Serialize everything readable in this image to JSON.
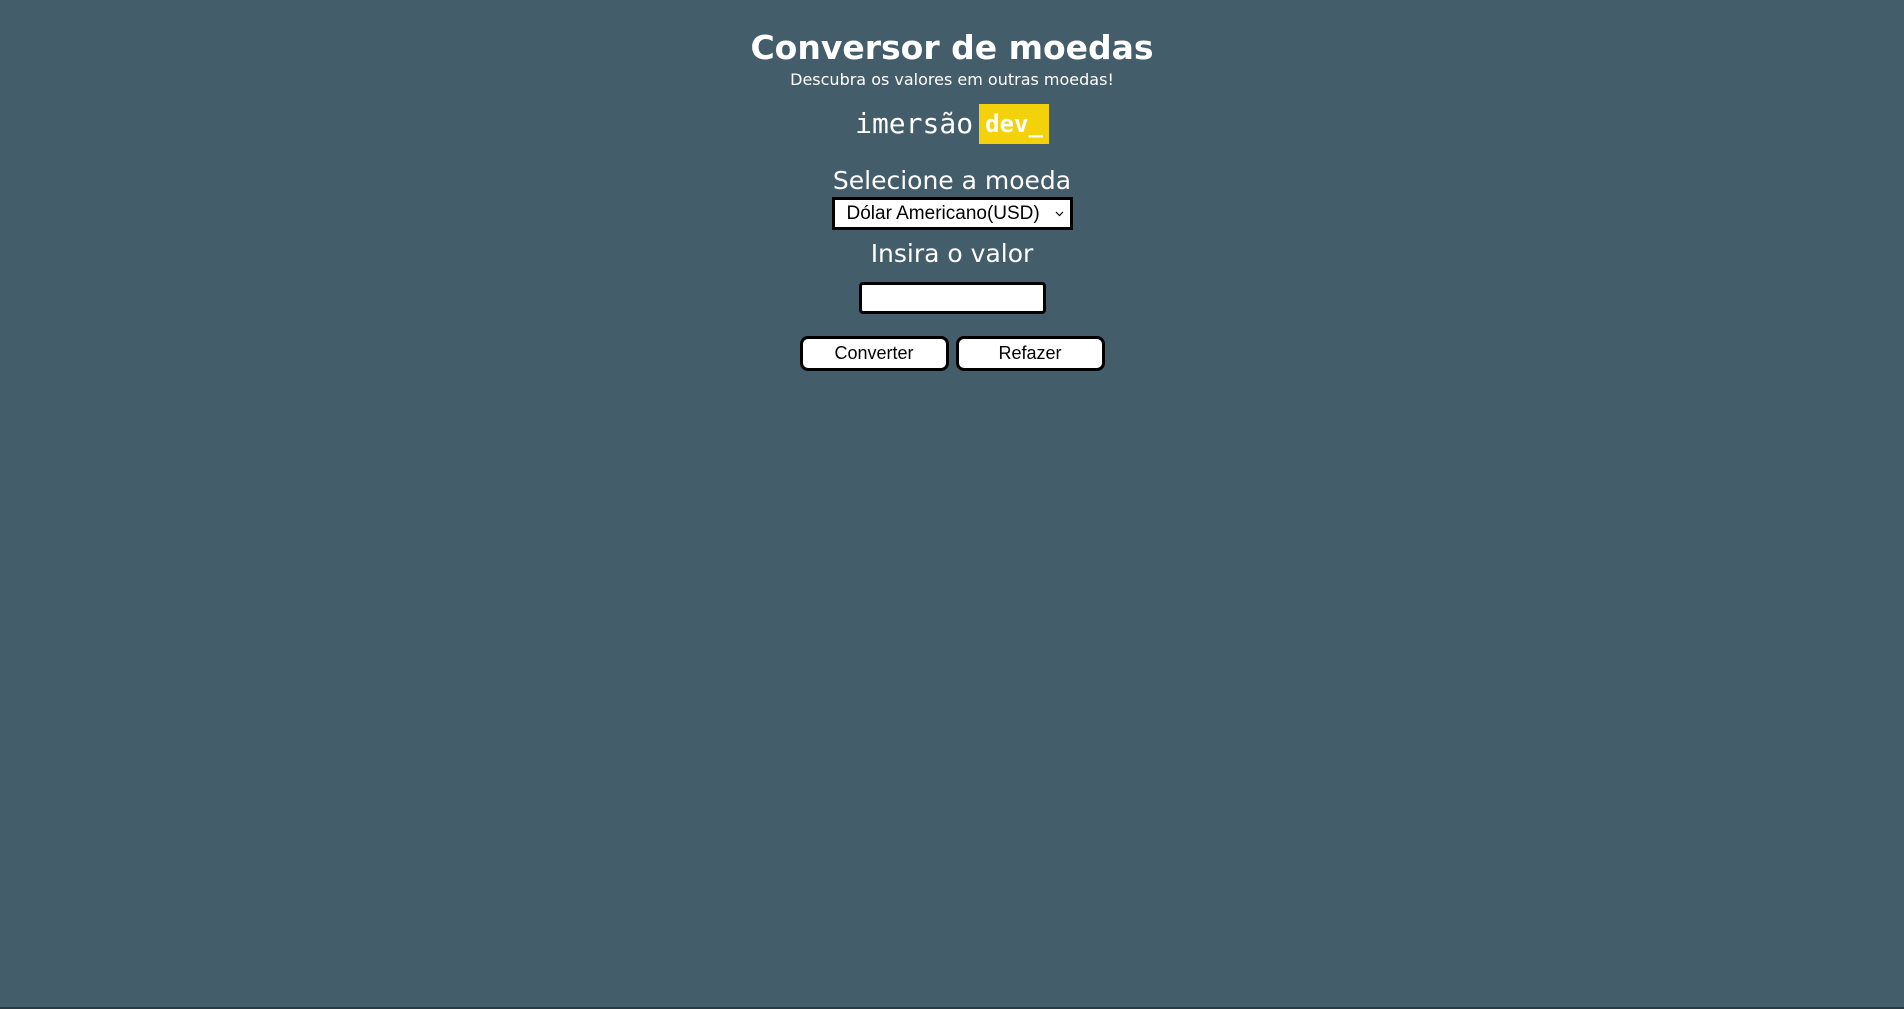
{
  "header": {
    "title": "Conversor de moedas",
    "subtitle": "Descubra os valores em outras moedas!"
  },
  "logo": {
    "text": "imersão",
    "badge": "dev_",
    "badge_color": "#f4d20b"
  },
  "form": {
    "select_label": "Selecione a moeda",
    "selected_currency": "Dólar Americano(USD)",
    "value_label": "Insira o valor",
    "value_input": "",
    "value_placeholder": ""
  },
  "buttons": {
    "convert_label": "Converter",
    "reset_label": "Refazer"
  },
  "colors": {
    "background": "#445d6a",
    "text": "#ffffff"
  }
}
